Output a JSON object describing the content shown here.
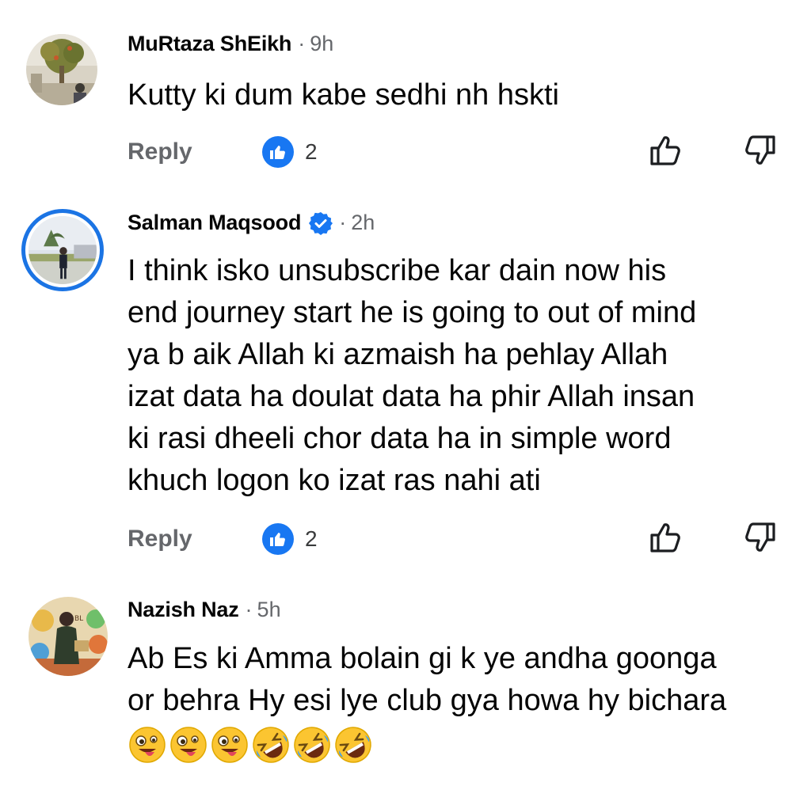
{
  "comments": [
    {
      "name": "MuRtaza ShEikh",
      "dot": "·",
      "time": "9h",
      "text": "Kutty ki dum kabe sedhi nh hskti",
      "reply_label": "Reply",
      "like_count": "2",
      "verified": false
    },
    {
      "name": "Salman Maqsood",
      "dot": "·",
      "time": "2h",
      "text": "I think isko unsubscribe kar dain now his\nend journey start he is going to out of mind\nya b aik Allah ki azmaish ha pehlay Allah\nizat data ha doulat data ha phir Allah insan\nki rasi dheeli chor data ha in simple word\nkhuch logon ko izat ras nahi ati",
      "reply_label": "Reply",
      "like_count": "2",
      "verified": true
    },
    {
      "name": "Nazish Naz",
      "dot": "·",
      "time": "5h",
      "text": "Ab Es ki Amma bolain gi k ye andha goonga\nor behra Hy esi lye club gya howa hy bichara",
      "emojis": [
        "winking-tongue-emoji",
        "winking-tongue-emoji",
        "winking-tongue-emoji",
        "rolling-laughing-emoji",
        "rolling-laughing-emoji",
        "rolling-laughing-emoji"
      ]
    }
  ],
  "colors": {
    "accent": "#1877f2",
    "secondary_text": "#65676b",
    "primary_text": "#050505",
    "emoji_yellow": "#fbc531"
  },
  "icons": {
    "like_badge": "thumbs-up-badge-icon",
    "like_action": "thumbs-up-outline-icon",
    "dislike_action": "thumbs-down-outline-icon",
    "verified": "verified-badge-icon"
  }
}
